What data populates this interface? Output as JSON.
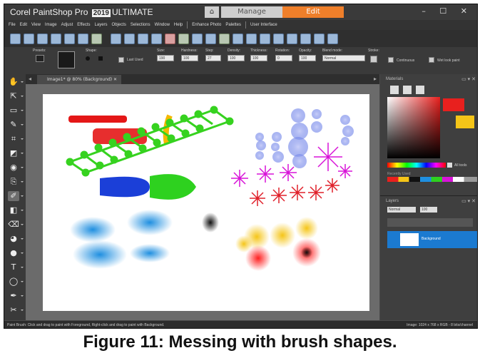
{
  "titlebar": {
    "brand": "Corel PaintShop Pro",
    "version": "2019",
    "edition": "ULTIMATE",
    "home_icon": "⌂",
    "tab_manage": "Manage",
    "tab_edit": "Edit",
    "window_controls": "– ☐ ✕"
  },
  "menu": [
    "File",
    "Edit",
    "View",
    "Image",
    "Adjust",
    "Effects",
    "Layers",
    "Objects",
    "Selections",
    "Window",
    "Help",
    "Enhance Photo",
    "Palettes",
    "User Interface"
  ],
  "options": {
    "presets": "Presets:",
    "shape": "Shape:",
    "last_used": "Last Used",
    "size_label": "Size:",
    "size": "190",
    "hardness_label": "Hardness:",
    "hardness": "100",
    "step_label": "Step:",
    "step": "27",
    "density_label": "Density:",
    "density": "100",
    "thickness_label": "Thickness:",
    "thickness": "100",
    "rotation_label": "Rotation:",
    "rotation": "0",
    "opacity_label": "Opacity:",
    "opacity": "100",
    "blend_label": "Blend mode:",
    "blend": "Normal",
    "stroke_label": "Stroke:",
    "continuous": "Continuous",
    "wet_look": "Wet look paint"
  },
  "document": {
    "tab_label": "Image1* @ 80% (Background)",
    "close": "✕"
  },
  "materials": {
    "title": "Materials",
    "all_tools": "All tools",
    "recently_used": "Recently Used"
  },
  "layers": {
    "title": "Layers",
    "blend": "Normal",
    "opacity": "100",
    "layer_name": "Background"
  },
  "status": {
    "left": "Paint Brush: Click and drag to paint with Foreground, Right-click and drag to paint with Background.",
    "right": "Image: 1024 x 768 x RGB - 8 bits/channel"
  },
  "caption": "Figure 11: Messing with brush shapes.",
  "colors": {
    "accent": "#ef7f2a",
    "foreground": "#e8201e",
    "background": "#f5c518"
  }
}
